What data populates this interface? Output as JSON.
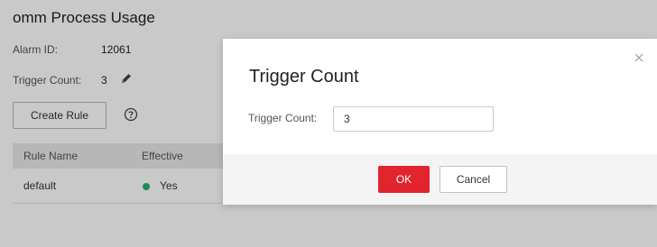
{
  "page": {
    "title": "omm Process Usage",
    "alarm_id_label": "Alarm ID:",
    "alarm_id_value": "12061",
    "trigger_count_label": "Trigger Count:",
    "trigger_count_value": "3",
    "create_rule_label": "Create Rule",
    "table": {
      "headers": [
        "Rule Name",
        "Effective"
      ],
      "rows": [
        {
          "rule_name": "default",
          "effective": "Yes"
        }
      ]
    }
  },
  "dialog": {
    "title": "Trigger Count",
    "field_label": "Trigger Count:",
    "field_value": "3",
    "ok_label": "OK",
    "cancel_label": "Cancel"
  },
  "icons": {
    "edit": "pencil-icon",
    "help": "question-circle-icon",
    "close": "close-icon",
    "status": "status-dot-icon"
  },
  "colors": {
    "primary": "#e2242e",
    "status_ok": "#27b36b",
    "overlay": "rgba(0,0,0,0.21)"
  }
}
